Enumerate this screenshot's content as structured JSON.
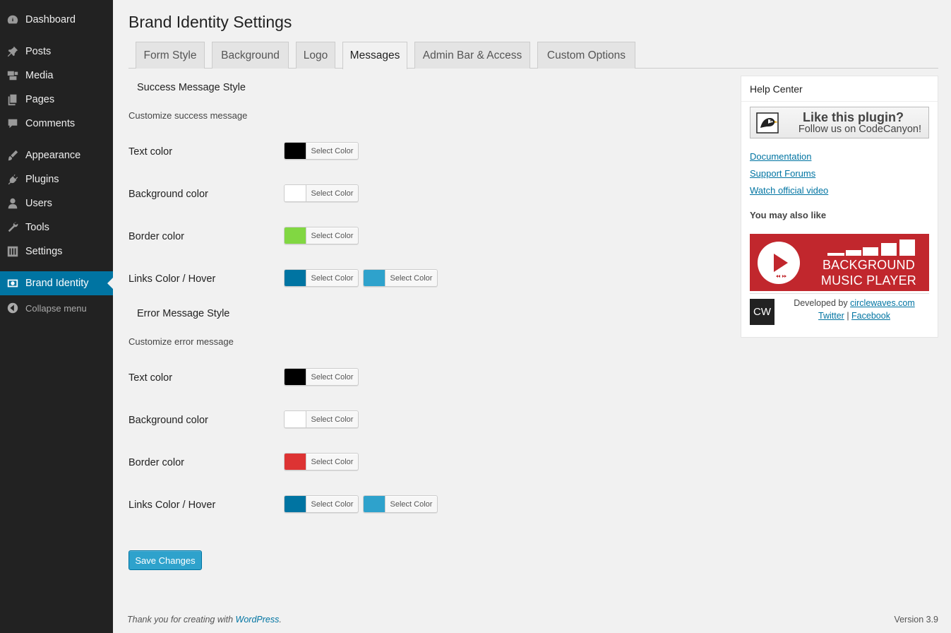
{
  "sidebar": {
    "items": [
      {
        "label": "Dashboard",
        "icon": "dashboard-icon"
      },
      {
        "label": "Posts",
        "icon": "pin-icon"
      },
      {
        "label": "Media",
        "icon": "media-icon"
      },
      {
        "label": "Pages",
        "icon": "pages-icon"
      },
      {
        "label": "Comments",
        "icon": "comment-icon"
      },
      {
        "label": "Appearance",
        "icon": "brush-icon"
      },
      {
        "label": "Plugins",
        "icon": "plug-icon"
      },
      {
        "label": "Users",
        "icon": "user-icon"
      },
      {
        "label": "Tools",
        "icon": "wrench-icon"
      },
      {
        "label": "Settings",
        "icon": "sliders-icon"
      },
      {
        "label": "Brand Identity",
        "icon": "eye-icon",
        "active": true
      }
    ],
    "collapse_label": "Collapse menu"
  },
  "page": {
    "title": "Brand Identity Settings"
  },
  "tabs": [
    {
      "label": "Form Style"
    },
    {
      "label": "Background"
    },
    {
      "label": "Logo"
    },
    {
      "label": "Messages",
      "active": true
    },
    {
      "label": "Admin Bar & Access"
    },
    {
      "label": "Custom Options"
    }
  ],
  "select_color_label": "Select Color",
  "success": {
    "title": "Success Message Style",
    "desc": "Customize success message",
    "text_color": {
      "label": "Text color",
      "color": "#000000"
    },
    "background_color": {
      "label": "Background color",
      "color": "#ffffff"
    },
    "border_color": {
      "label": "Border color",
      "color": "#81d742"
    },
    "links": {
      "label": "Links Color / Hover",
      "color": "#0074a2",
      "hover": "#2ea2cc"
    }
  },
  "error": {
    "title": "Error Message Style",
    "desc": "Customize error message",
    "text_color": {
      "label": "Text color",
      "color": "#000000"
    },
    "background_color": {
      "label": "Background color",
      "color": "#ffffff"
    },
    "border_color": {
      "label": "Border color",
      "color": "#dd3333"
    },
    "links": {
      "label": "Links Color / Hover",
      "color": "#0074a2",
      "hover": "#2ea2cc"
    }
  },
  "save_label": "Save Changes",
  "footer": {
    "thanks_prefix": "Thank you for creating with ",
    "thanks_link": "WordPress",
    "thanks_suffix": ".",
    "version": "Version 3.9"
  },
  "help": {
    "title": "Help Center",
    "codecanyon_line1": "Like this plugin?",
    "codecanyon_line2": "Follow us on CodeCanyon!",
    "links": [
      "Documentation",
      "Support Forums",
      "Watch official video"
    ],
    "also_like": "You may also like",
    "bmp_line1": "BACKGROUND",
    "bmp_line2": "MUSIC PLAYER",
    "cw_logo": "CW",
    "developed_by": "Developed by ",
    "developer_link": "circlewaves.com",
    "twitter": "Twitter",
    "separator": " | ",
    "facebook": "Facebook"
  },
  "colors": {
    "sidebar_bg": "#222222",
    "accent": "#0074a2",
    "button": "#2ea2cc",
    "bmp_red": "#c1272d"
  }
}
